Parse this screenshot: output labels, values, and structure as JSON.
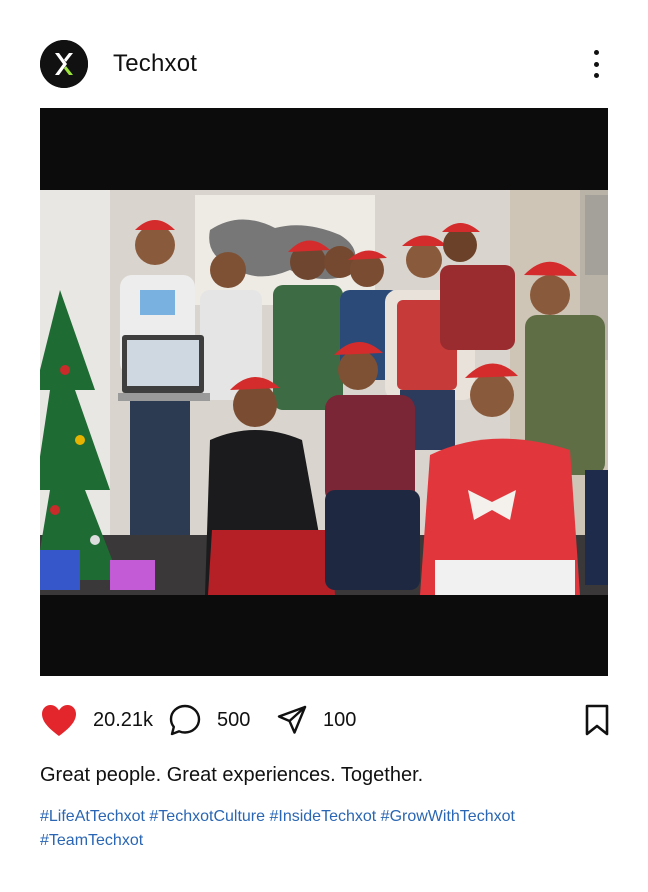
{
  "account": {
    "name": "Techxot",
    "avatar_icon": "techxot-logo-icon"
  },
  "menu_icon": "more-vertical-icon",
  "media": {
    "kind": "group photo",
    "background": "#0c0c0c"
  },
  "actions": {
    "like": {
      "icon": "heart-icon",
      "count": "20.21k",
      "color": "#e3262b"
    },
    "comment": {
      "icon": "comment-icon",
      "count": "500"
    },
    "share": {
      "icon": "send-icon",
      "count": "100"
    },
    "save": {
      "icon": "bookmark-icon"
    }
  },
  "caption": "Great people. Great experiences. Together.",
  "hashtags": [
    "#LifeAtTechxot",
    "#TechxotCulture",
    "#InsideTechxot",
    "#GrowWithTechxot",
    "#TeamTechxot"
  ],
  "colors": {
    "hashtag": "#2a66b3",
    "text": "#111111",
    "logo_accent": "#9be33a"
  }
}
